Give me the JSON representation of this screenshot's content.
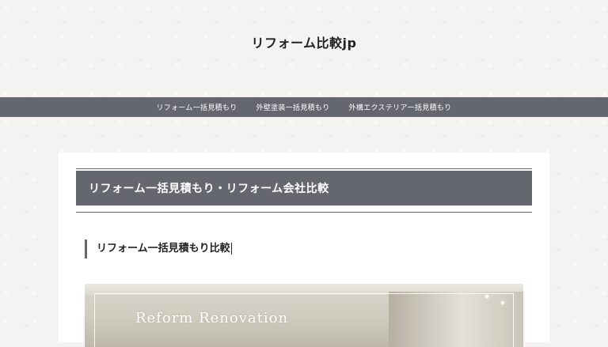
{
  "site": {
    "title": "リフォーム比較jp"
  },
  "nav": {
    "items": [
      {
        "label": "リフォーム一括見積もり"
      },
      {
        "label": "外壁塗装一括見積もり"
      },
      {
        "label": "外構エクステリア一括見積もり"
      }
    ]
  },
  "main": {
    "page_title": "リフォーム一括見積もり・リフォーム会社比較",
    "section_heading": "リフォーム一括見積もり比較",
    "hero_text": "Reform Renovation"
  },
  "colors": {
    "nav_bg": "#65676f",
    "page_bg": "#f4f3f1",
    "content_bg": "#ffffff"
  }
}
